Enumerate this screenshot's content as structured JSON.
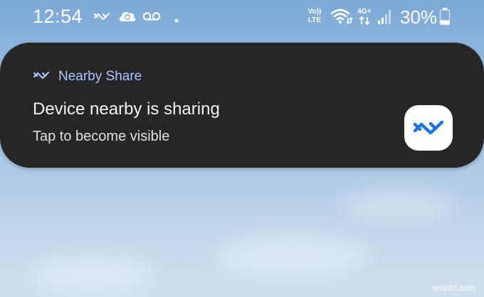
{
  "status_bar": {
    "time": "12:54",
    "left_icons": [
      "nearby-share-icon",
      "cloud-sync-icon",
      "voicemail-icon",
      "dot-icon"
    ],
    "volte_label_top": "Vo))",
    "volte_label_bottom": "LTE",
    "network_label": "4G+",
    "battery_percent": "30%",
    "battery_level": 0.3
  },
  "notification": {
    "app_name": "Nearby Share",
    "title": "Device nearby is sharing",
    "body": "Tap to become visible",
    "accent_color": "#a9c6ff",
    "icon_color": "#1a73e8"
  },
  "watermark": "wsxdn.com"
}
